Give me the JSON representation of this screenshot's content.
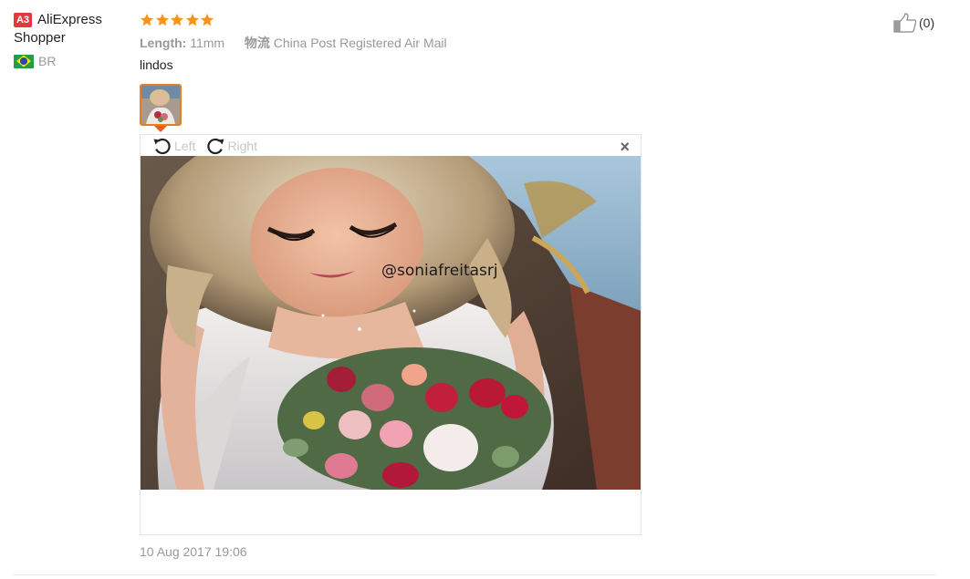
{
  "user": {
    "badge": "A3",
    "name_line1": "AliExpress",
    "name_line2": "Shopper",
    "country_code": "BR",
    "flag_icon": "brazil-flag-icon"
  },
  "review": {
    "rating": 5,
    "rating_max": 5,
    "star_color": "#f7941d",
    "length_label": "Length:",
    "length_value": "11mm",
    "shipping_label": "物流",
    "shipping_value": "China Post Registered Air Mail",
    "comment": "lindos",
    "date": "10 Aug 2017 19:06"
  },
  "viewer": {
    "rotate_left_label": "Left",
    "rotate_right_label": "Right",
    "close_glyph": "×",
    "watermark": "@soniafreitasrj"
  },
  "helpful": {
    "count_text": "(0)",
    "icon": "thumbs-up-icon"
  },
  "colors": {
    "badge_bg": "#e4393c",
    "thumb_border": "#e67e22",
    "muted_text": "#999999"
  }
}
